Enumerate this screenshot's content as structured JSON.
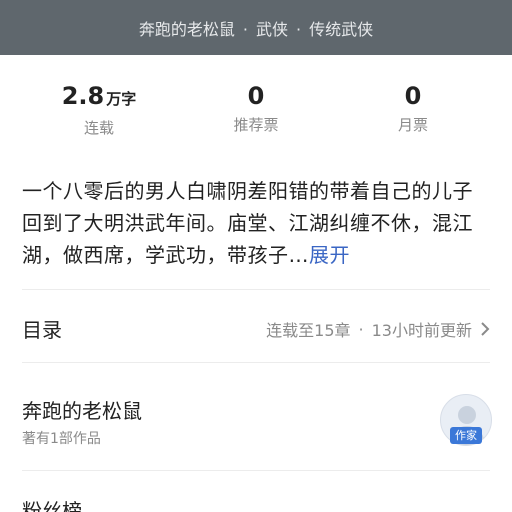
{
  "header": {
    "title": "",
    "author": "奔跑的老松鼠",
    "category": "武侠",
    "subcategory": "传统武侠",
    "separator": "·"
  },
  "stats": [
    {
      "value": "2.8",
      "unit": "万字",
      "label": "连载"
    },
    {
      "value": "0",
      "unit": "",
      "label": "推荐票"
    },
    {
      "value": "0",
      "unit": "",
      "label": "月票"
    }
  ],
  "intro": {
    "text": "一个八零后的男人白啸阴差阳错的带着自己的儿子回到了大明洪武年间。庙堂、江湖纠缠不休，混江湖，做西席，学武功，带孩子…",
    "expand_label": "展开"
  },
  "toc": {
    "title": "目录",
    "status": "连载至15章",
    "separator": "·",
    "updated": "13小时前更新"
  },
  "author": {
    "name": "奔跑的老松鼠",
    "works": "著有1部作品",
    "badge": "作家"
  },
  "fans": {
    "title": "粉丝榜"
  },
  "colors": {
    "header_bg": "#5f676d",
    "link": "#3a66c4",
    "badge": "#3b78d8"
  }
}
